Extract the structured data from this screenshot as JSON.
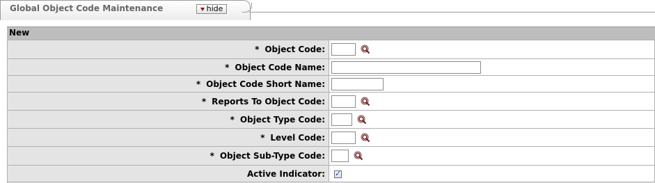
{
  "tab": {
    "title": "Global Object Code Maintenance",
    "hide_label": "hide"
  },
  "section": {
    "title": "New"
  },
  "fields": [
    {
      "label": "Object Code:",
      "required": true,
      "type": "text",
      "value": ""
    },
    {
      "label": "Object Code Name:",
      "required": true,
      "type": "text",
      "value": ""
    },
    {
      "label": "Object Code Short Name:",
      "required": true,
      "type": "text",
      "value": ""
    },
    {
      "label": "Reports To Object Code:",
      "required": true,
      "type": "text",
      "value": ""
    },
    {
      "label": "Object Type Code:",
      "required": true,
      "type": "text",
      "value": ""
    },
    {
      "label": "Level Code:",
      "required": true,
      "type": "text",
      "value": ""
    },
    {
      "label": "Object Sub-Type Code:",
      "required": true,
      "type": "text",
      "value": ""
    },
    {
      "label": "Active Indicator:",
      "required": false,
      "type": "checkbox",
      "checked": true
    }
  ],
  "required_marker": "*",
  "check_mark": "✓",
  "colors": {
    "lookup_icon": "#8b1a1a",
    "header_bg": "#bdbdbd",
    "label_bg": "#e4e4e4"
  }
}
